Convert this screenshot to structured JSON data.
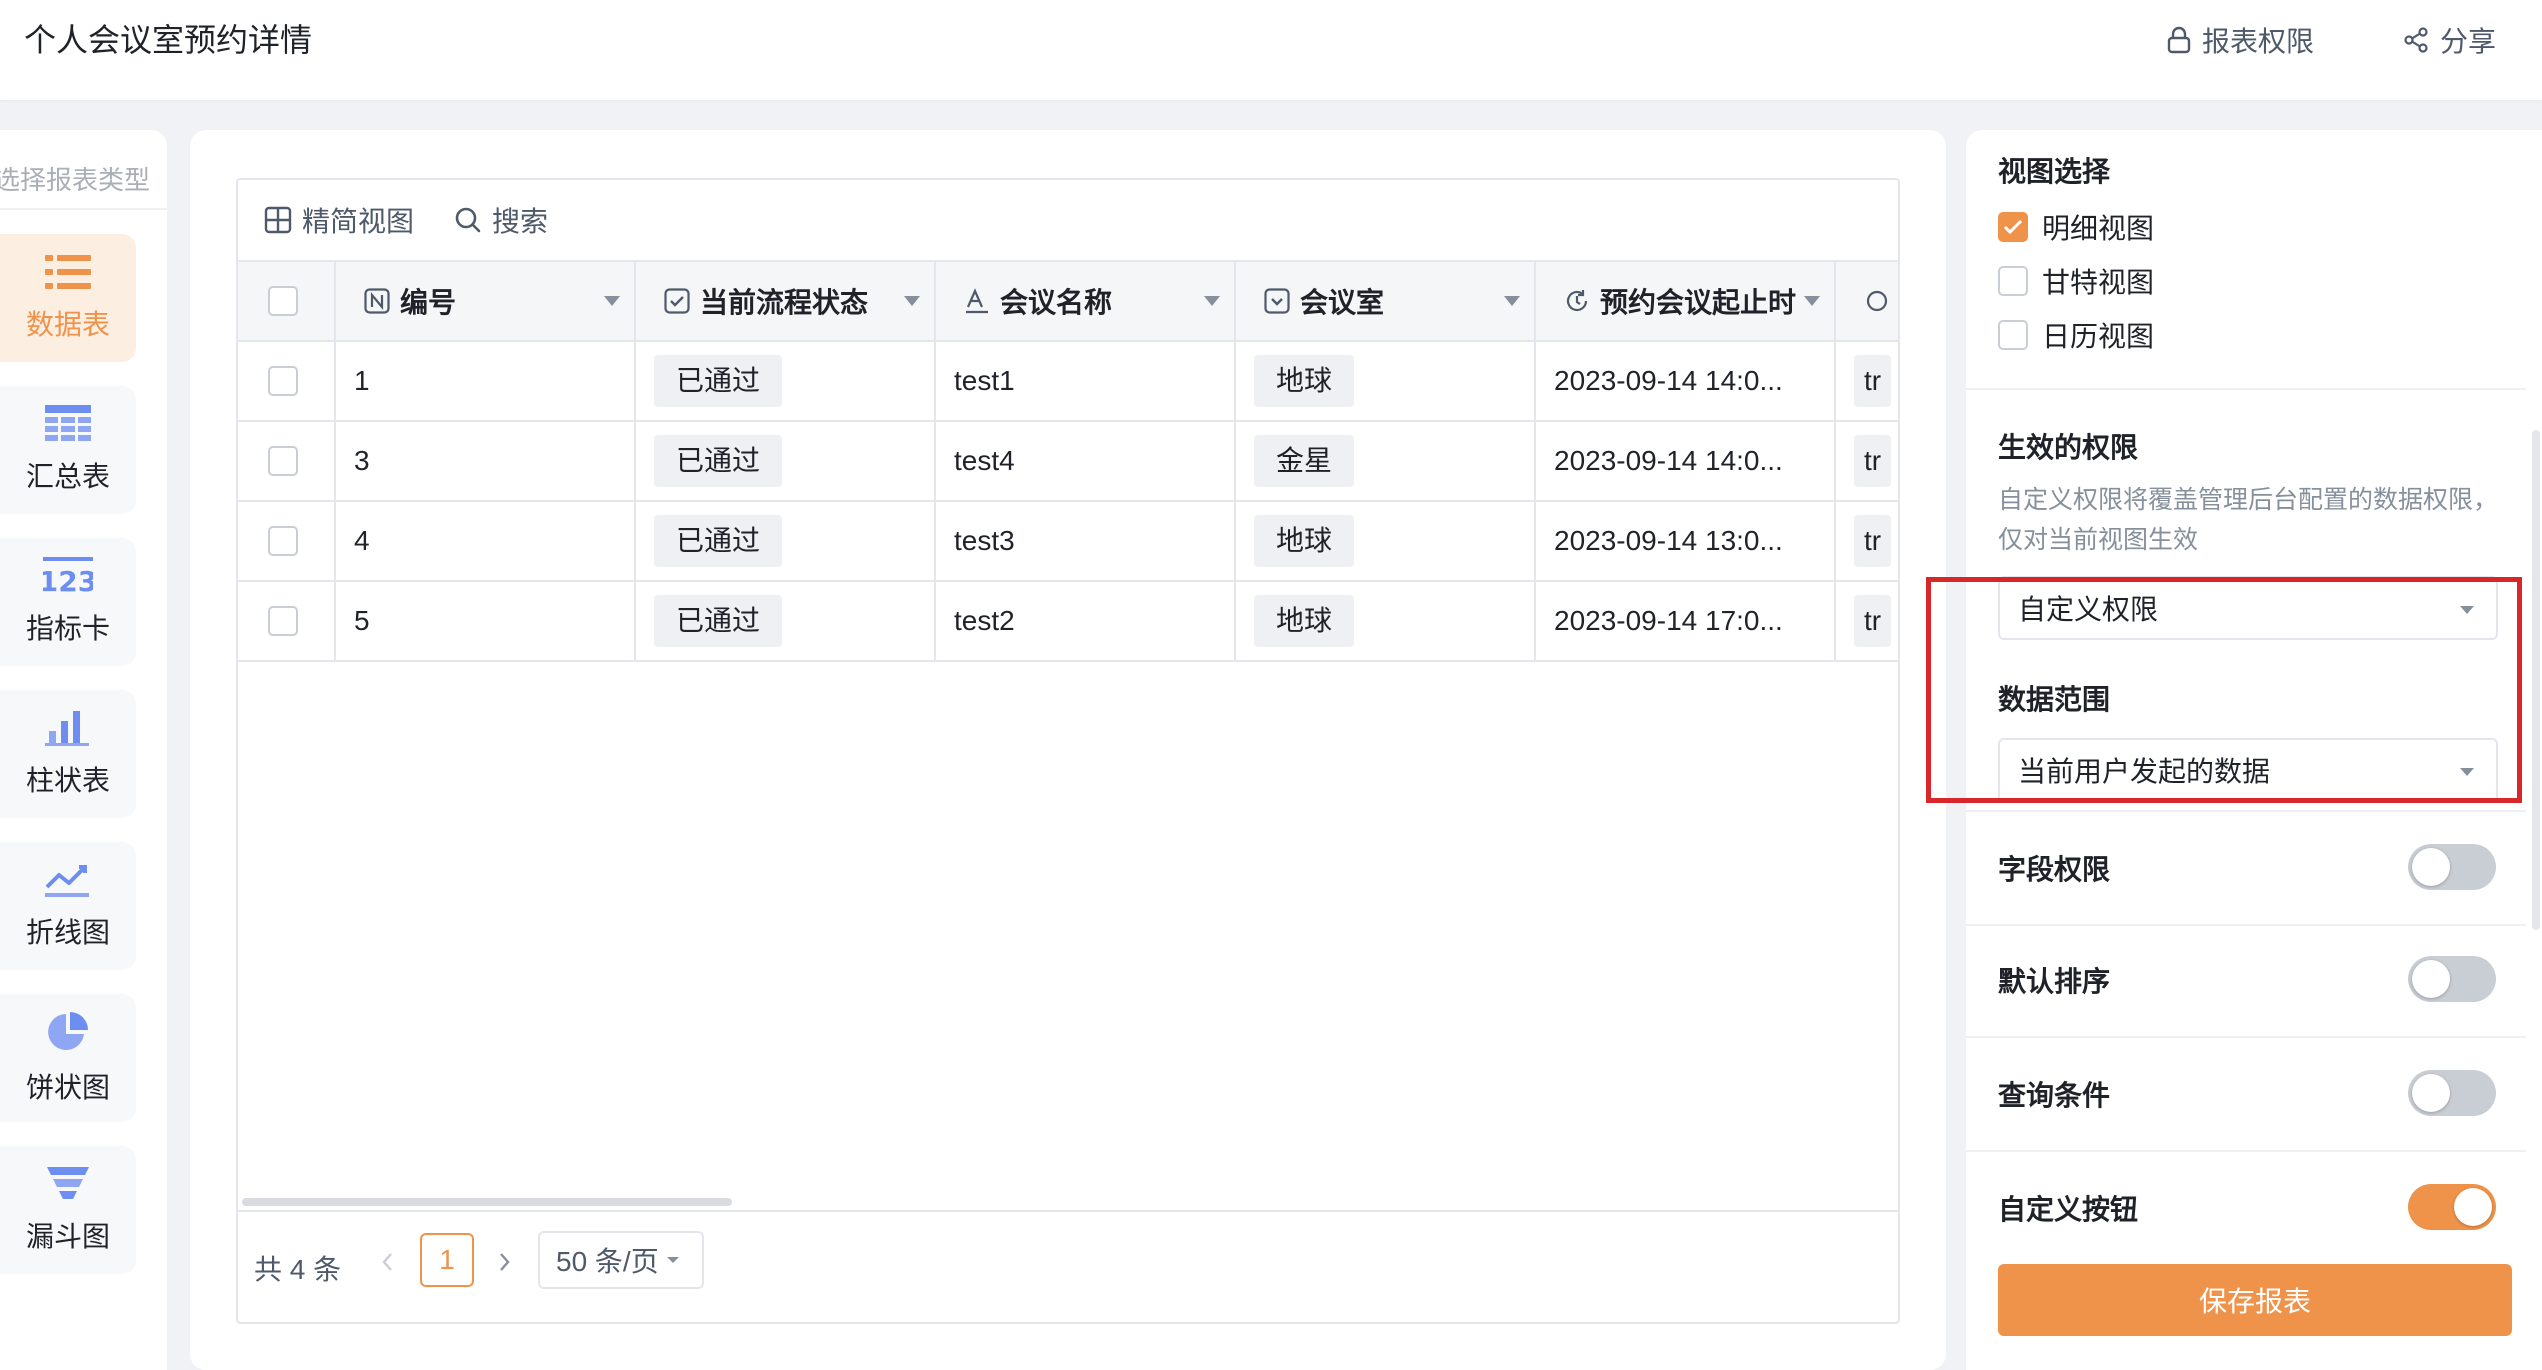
{
  "page": {
    "title": "个人会议室预约详情"
  },
  "top_actions": {
    "permission": "报表权限",
    "share": "分享"
  },
  "left_sidebar": {
    "title": "选择报表类型",
    "items": [
      {
        "label": "数据表",
        "icon": "list-icon",
        "active": true
      },
      {
        "label": "汇总表",
        "icon": "table-grid-icon",
        "active": false
      },
      {
        "label": "指标卡",
        "icon": "number-123-icon",
        "active": false
      },
      {
        "label": "柱状表",
        "icon": "bar-chart-icon",
        "active": false
      },
      {
        "label": "折线图",
        "icon": "line-chart-icon",
        "active": false
      },
      {
        "label": "饼状图",
        "icon": "pie-chart-icon",
        "active": false
      },
      {
        "label": "漏斗图",
        "icon": "funnel-icon",
        "active": false
      }
    ]
  },
  "table": {
    "toolbar": {
      "simple_view": "精简视图",
      "search": "搜索"
    },
    "columns": [
      {
        "label": "编号",
        "icon": "number-field-icon"
      },
      {
        "label": "当前流程状态",
        "icon": "status-field-icon"
      },
      {
        "label": "会议名称",
        "icon": "text-field-icon"
      },
      {
        "label": "会议室",
        "icon": "select-field-icon"
      },
      {
        "label": "预约会议起止时",
        "icon": "time-field-icon"
      }
    ],
    "rows": [
      {
        "id": "1",
        "status": "已通过",
        "name": "test1",
        "room": "地球",
        "time": "2023-09-14 14:0...",
        "extra": "tr"
      },
      {
        "id": "3",
        "status": "已通过",
        "name": "test4",
        "room": "金星",
        "time": "2023-09-14 14:0...",
        "extra": "tr"
      },
      {
        "id": "4",
        "status": "已通过",
        "name": "test3",
        "room": "地球",
        "time": "2023-09-14 13:0...",
        "extra": "tr"
      },
      {
        "id": "5",
        "status": "已通过",
        "name": "test2",
        "room": "地球",
        "time": "2023-09-14 17:0...",
        "extra": "tr"
      }
    ],
    "pagination": {
      "total": "共 4 条",
      "current": "1",
      "page_size": "50 条/页"
    }
  },
  "right_panel": {
    "view_select": {
      "title": "视图选择",
      "options": [
        {
          "label": "明细视图",
          "checked": true
        },
        {
          "label": "甘特视图",
          "checked": false
        },
        {
          "label": "日历视图",
          "checked": false
        }
      ]
    },
    "permission": {
      "title": "生效的权限",
      "description": "自定义权限将覆盖管理后台配置的数据权限，仅对当前视图生效",
      "value": "自定义权限"
    },
    "data_range": {
      "title": "数据范围",
      "value": "当前用户发起的数据"
    },
    "toggles": [
      {
        "label": "字段权限",
        "on": false
      },
      {
        "label": "默认排序",
        "on": false
      },
      {
        "label": "查询条件",
        "on": false
      },
      {
        "label": "自定义按钮",
        "on": true
      }
    ],
    "save_button": "保存报表"
  },
  "colors": {
    "accent": "#f0934a",
    "highlight_border": "#d9262b",
    "tag_bg": "#eef0f3"
  }
}
